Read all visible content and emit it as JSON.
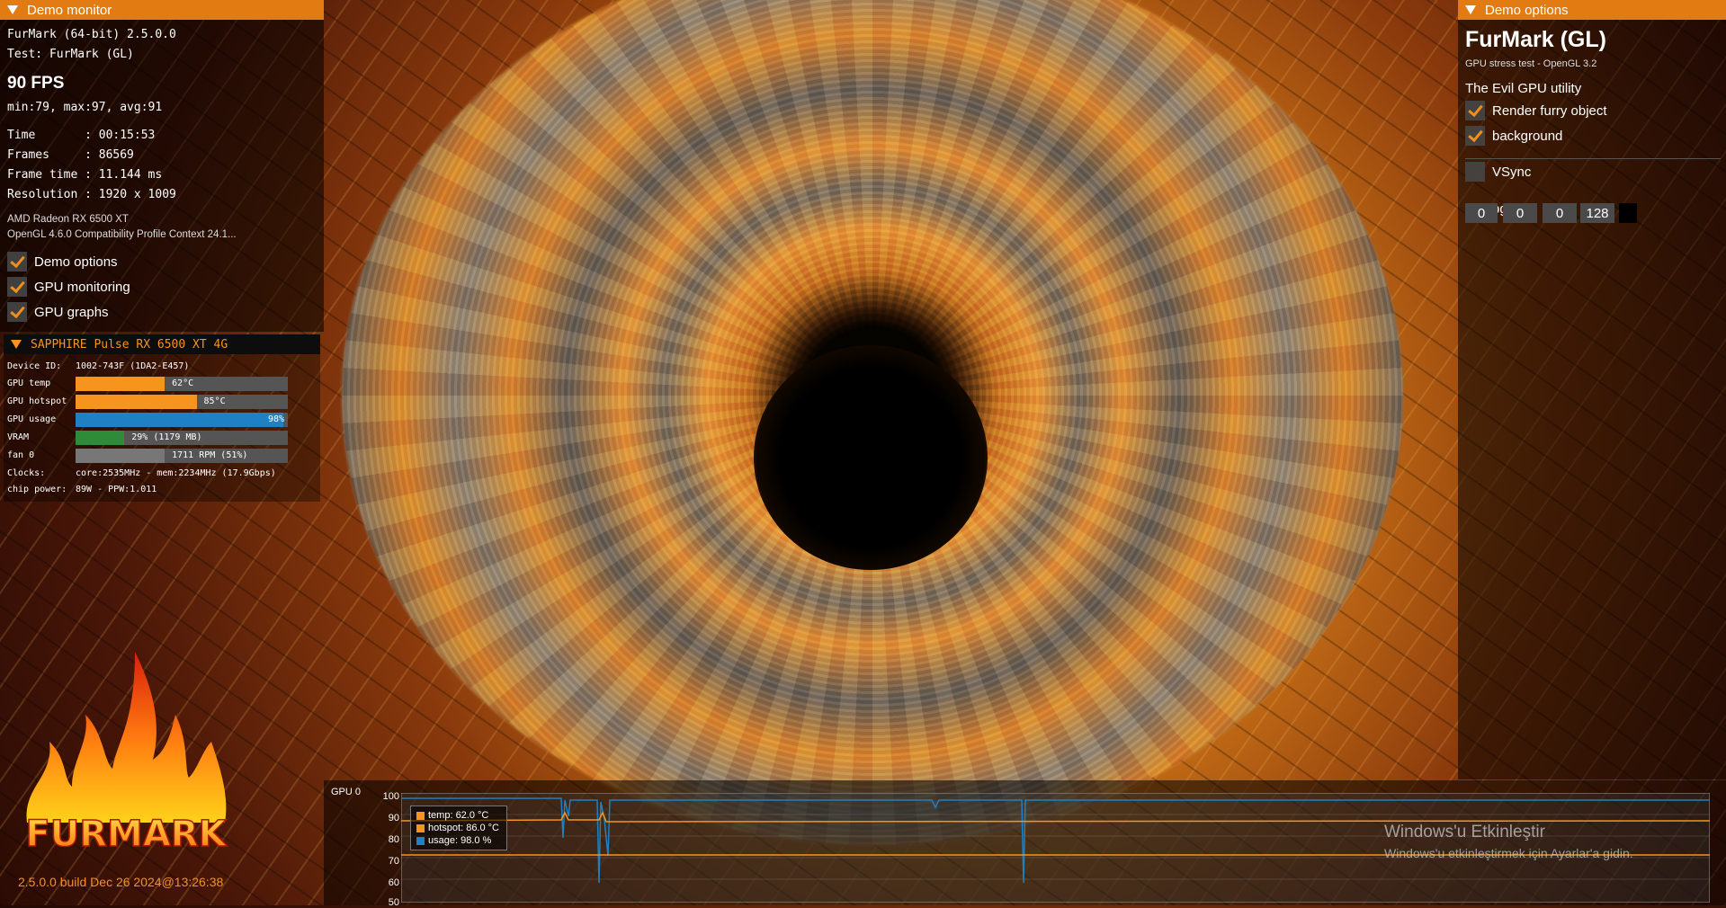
{
  "left_panel": {
    "header": "Demo monitor",
    "app_line": "FurMark (64-bit) 2.5.0.0",
    "test_line": "Test: FurMark (GL)",
    "fps": "90 FPS",
    "fps_stats": "min:79, max:97, avg:91",
    "stats": [
      {
        "label": "Time       : ",
        "value": "00:15:53"
      },
      {
        "label": "Frames     : ",
        "value": "86569"
      },
      {
        "label": "Frame time : ",
        "value": "11.144 ms"
      },
      {
        "label": "Resolution : ",
        "value": "1920 x 1009"
      }
    ],
    "gpu_name": "AMD Radeon RX 6500 XT",
    "gl_context": "OpenGL 4.6.0 Compatibility Profile Context 24.1...",
    "checkboxes": [
      {
        "label": "Demo options",
        "checked": true
      },
      {
        "label": "GPU monitoring",
        "checked": true
      },
      {
        "label": "GPU graphs",
        "checked": true
      }
    ]
  },
  "gpu_monitor": {
    "header": "SAPPHIRE Pulse RX 6500 XT 4G",
    "device_id_label": "Device ID:",
    "device_id": "1002-743F (1DA2-E457)",
    "bars": [
      {
        "label": "GPU temp",
        "text": "62°C",
        "fraction": 0.42,
        "color": "#f7941d"
      },
      {
        "label": "GPU hotspot",
        "text": "85°C",
        "fraction": 0.57,
        "color": "#f7941d"
      },
      {
        "label": "GPU usage",
        "text": "98%",
        "fraction": 0.98,
        "color": "#1f80c4"
      },
      {
        "label": "VRAM",
        "text": "29% (1179 MB)",
        "fraction": 0.23,
        "color": "#2e8b3a"
      },
      {
        "label": "fan 0",
        "text": "1711 RPM (51%)",
        "fraction": 0.42,
        "color": "#777777"
      }
    ],
    "clocks_label": "Clocks:",
    "clocks": "core:2535MHz - mem:2234MHz (17.9Gbps)",
    "power_label": "chip power:",
    "power": "89W - PPW:1.011"
  },
  "branding": {
    "logo_text": "FURMARK",
    "build": "2.5.0.0 build Dec 26 2024@13:26:38"
  },
  "right_panel": {
    "header": "Demo options",
    "title": "FurMark (GL)",
    "subtitle": "GPU stress test - OpenGL 3.2",
    "tagline": "The Evil GPU utility",
    "options": [
      {
        "label": "Render furry object",
        "checked": true
      },
      {
        "label": "background",
        "checked": true
      }
    ],
    "vsync": {
      "label": "VSync",
      "checked": false
    },
    "osi_label": "OSI bgcolor",
    "osi_values": [
      "0",
      "0",
      "0",
      "128"
    ],
    "osi_swatch": "#000000"
  },
  "graph": {
    "label": "GPU 0",
    "yticks": [
      "100",
      "90",
      "80",
      "70",
      "60",
      "50"
    ],
    "legend": [
      {
        "text": "temp: 62.0 °C",
        "color": "#f7941d"
      },
      {
        "text": "hotspot: 86.0 °C",
        "color": "#f7941d"
      },
      {
        "text": "usage: 98.0 %",
        "color": "#1f80c4"
      }
    ]
  },
  "activation": {
    "title": "Windows'u Etkinleştir",
    "subtitle": "Windows'u etkinleştirmek için Ayarlar'a gidin."
  }
}
